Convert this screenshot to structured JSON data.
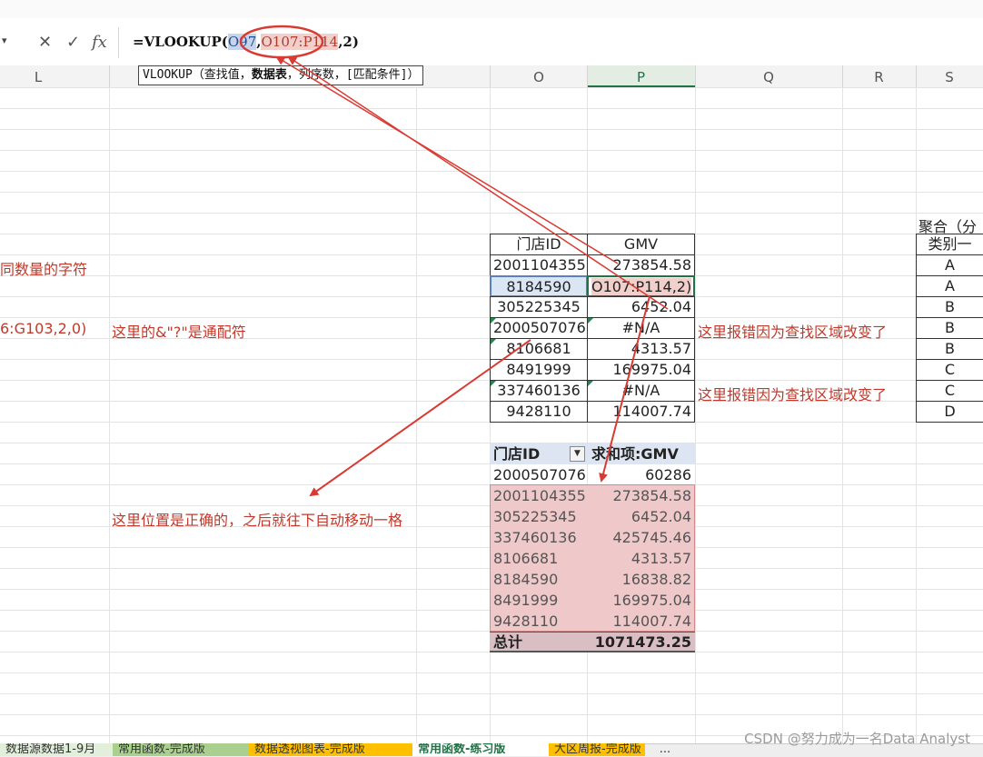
{
  "formula_bar": {
    "cancel_icon": "x-icon",
    "confirm_icon": "check-icon",
    "fx_label": "fx",
    "prefix": "=VLOOKUP(",
    "ref1": "O97",
    "comma1": ",",
    "ref2": "O107:P114",
    "suffix": ",2)"
  },
  "tooltip": {
    "func": "VLOOKUP",
    "open": "（查找值，",
    "bold_arg": "数据表",
    "rest": "，列序数，[匹配条件]）"
  },
  "columns": [
    "L",
    "O",
    "P",
    "Q",
    "R",
    "S"
  ],
  "notes": {
    "left_1": "同数量的字符",
    "left_2": "6:G103,2,0)",
    "wildcard": "这里的&\"?\"是通配符",
    "error_1": "这里报错因为查找区域改变了",
    "error_2": "这里报错因为查找区域改变了",
    "position": "这里位置是正确的，之后就往下自动移动一格"
  },
  "table1": {
    "headers": [
      "门店ID",
      "GMV"
    ],
    "rows": [
      [
        "2001104355",
        "273854.58"
      ],
      [
        "8184590",
        "O107:P114,2)"
      ],
      [
        "305225345",
        "6452.04"
      ],
      [
        "2000507076",
        "#N/A"
      ],
      [
        "8106681",
        "4313.57"
      ],
      [
        "8491999",
        "169975.04"
      ],
      [
        "337460136",
        "#N/A"
      ],
      [
        "9428110",
        "114007.74"
      ]
    ]
  },
  "pivot": {
    "header_id": "门店ID",
    "header_sum": "求和项:GMV",
    "filter_icon": "dropdown-filter-icon",
    "rows": [
      [
        "2000507076",
        "60286"
      ],
      [
        "2001104355",
        "273854.58"
      ],
      [
        "305225345",
        "6452.04"
      ],
      [
        "337460136",
        "425745.46"
      ],
      [
        "8106681",
        "4313.57"
      ],
      [
        "8184590",
        "16838.82"
      ],
      [
        "8491999",
        "169975.04"
      ],
      [
        "9428110",
        "114007.74"
      ]
    ],
    "total_label": "总计",
    "total_value": "1071473.25"
  },
  "right_table": {
    "title": "聚合（分",
    "header": "类别一",
    "values": [
      "A",
      "A",
      "B",
      "B",
      "B",
      "C",
      "C",
      "D"
    ]
  },
  "sheet_tabs": [
    {
      "label": "数据源数据1-9月",
      "color": "#e2efda"
    },
    {
      "label": "常用函数-完成版",
      "color": "#a9d08e"
    },
    {
      "label": "数据透视图表-完成版",
      "color": "#ffc000"
    },
    {
      "label": "常用函数-练习版",
      "color": "#ffffff"
    },
    {
      "label": "大区周报-完成版",
      "color": "#ffc000"
    }
  ],
  "more_tabs": "...",
  "watermark": "CSDN @努力成为一名Data Analyst",
  "colors": {
    "annotation_red": "#d93a32",
    "active_green": "#217346"
  }
}
